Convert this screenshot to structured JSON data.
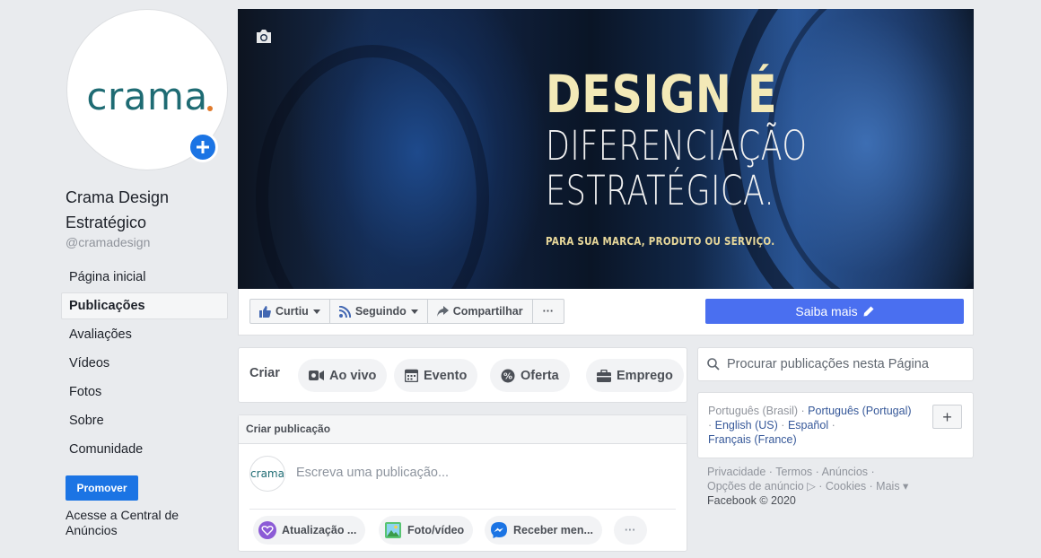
{
  "profile": {
    "logo_text": "crama",
    "name": "Crama Design Estratégico",
    "handle": "@cramadesign"
  },
  "nav": [
    {
      "label": "Página inicial",
      "active": false
    },
    {
      "label": "Publicações",
      "active": true
    },
    {
      "label": "Avaliações",
      "active": false
    },
    {
      "label": "Vídeos",
      "active": false
    },
    {
      "label": "Fotos",
      "active": false
    },
    {
      "label": "Sobre",
      "active": false
    },
    {
      "label": "Comunidade",
      "active": false
    }
  ],
  "promote": {
    "label": "Promover",
    "ads_link": "Acesse a Central de Anúncios"
  },
  "cover": {
    "line1": "DESIGN É",
    "line2": "DIFERENCIAÇÃO",
    "line3": "ESTRATÉGICA.",
    "line4": "PARA SUA MARCA, PRODUTO OU SERVIÇO."
  },
  "actions": {
    "like": "Curtiu",
    "follow": "Seguindo",
    "share": "Compartilhar",
    "more": "···",
    "cta": "Saiba mais"
  },
  "create": {
    "label": "Criar",
    "options": [
      "Ao vivo",
      "Evento",
      "Oferta",
      "Emprego"
    ]
  },
  "post_composer": {
    "header": "Criar publicação",
    "avatar_text": "crama",
    "placeholder": "Escreva uma publicação...",
    "options": [
      "Atualização ...",
      "Foto/vídeo",
      "Receber men...",
      "···"
    ]
  },
  "search": {
    "placeholder": "Procurar publicações nesta Página"
  },
  "languages": {
    "current": "Português (Brasil)",
    "links": [
      "Português (Portugal)",
      "English (US)",
      "Español",
      "Français (France)"
    ],
    "add": "+"
  },
  "footer": {
    "line1": "Privacidade · Termos · Anúncios ·",
    "line2": "Opções de anúncio ▷ · Cookies · Mais ▾",
    "copyright": "Facebook © 2020"
  },
  "colors": {
    "brand_blue": "#1b74e4",
    "cta_blue": "#4a6ff0",
    "logo_teal": "#1e6b73"
  }
}
